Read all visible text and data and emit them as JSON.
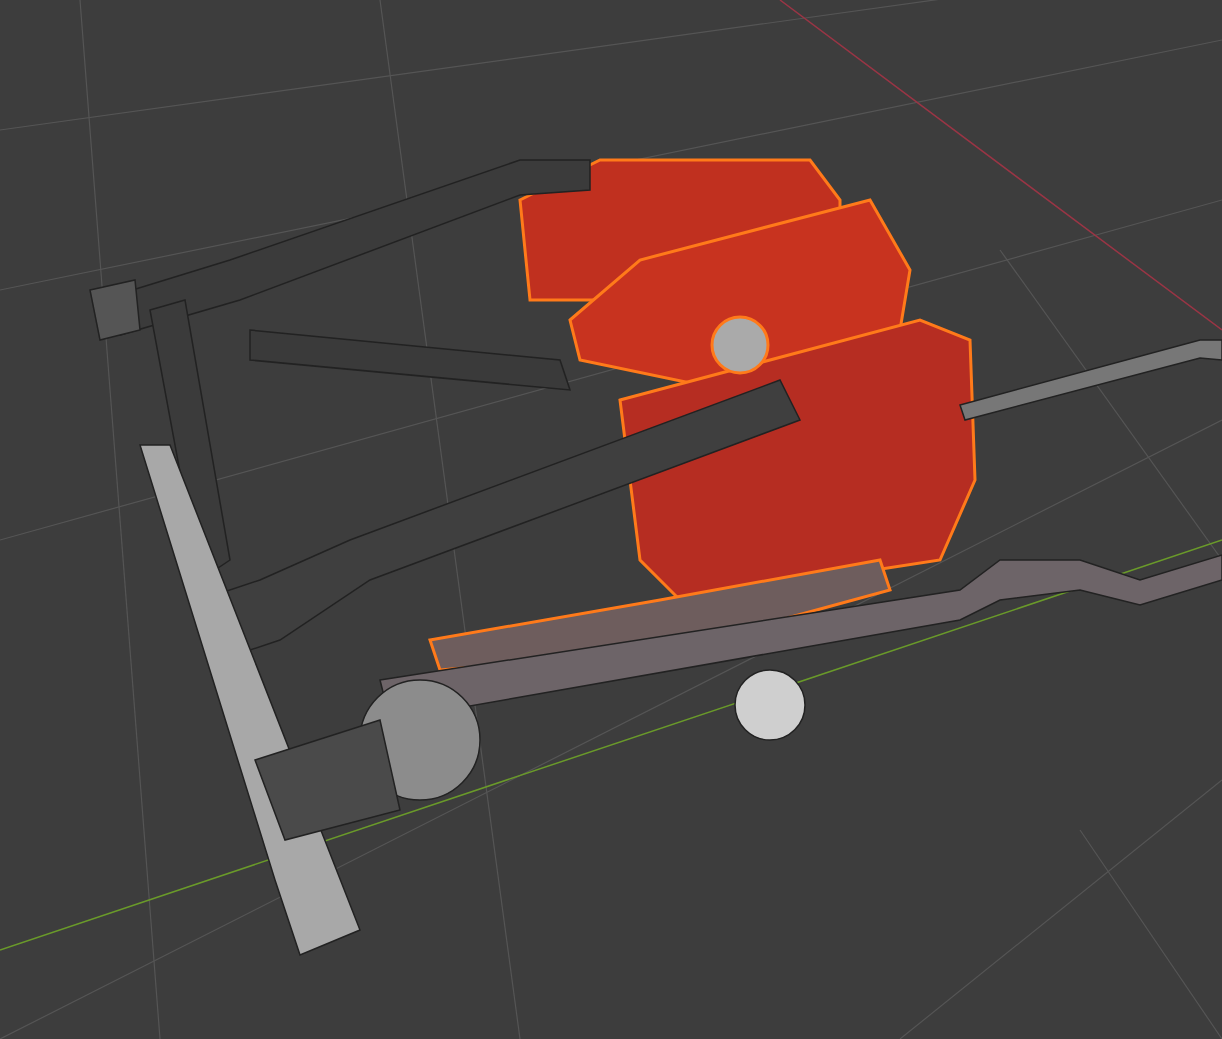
{
  "viewport": {
    "objects": [
      {
        "kind": "engine",
        "selected": true
      },
      {
        "kind": "hoses",
        "selected": false
      },
      {
        "kind": "exhaust",
        "selected": false
      }
    ]
  }
}
